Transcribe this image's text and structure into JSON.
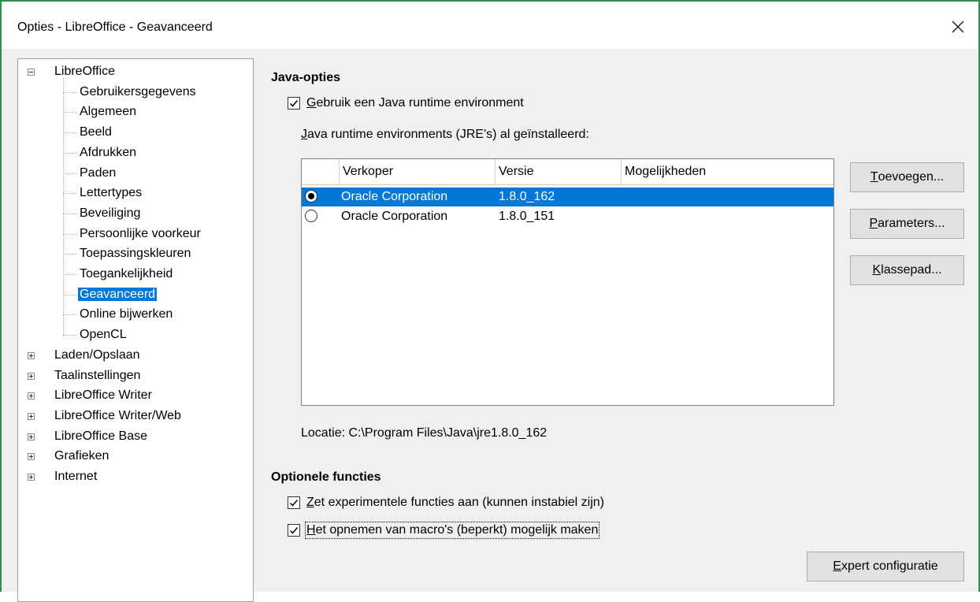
{
  "window": {
    "title": "Opties - LibreOffice - Geavanceerd"
  },
  "tree": {
    "root": "LibreOffice",
    "children": [
      "Gebruikersgegevens",
      "Algemeen",
      "Beeld",
      "Afdrukken",
      "Paden",
      "Lettertypes",
      "Beveiliging",
      "Persoonlijke voorkeur",
      "Toepassingskleuren",
      "Toegankelijkheid",
      "Geavanceerd",
      "Online bijwerken",
      "OpenCL"
    ],
    "selected": "Geavanceerd",
    "collapsed": [
      "Laden/Opslaan",
      "Taalinstellingen",
      "LibreOffice Writer",
      "LibreOffice Writer/Web",
      "LibreOffice Base",
      "Grafieken",
      "Internet"
    ]
  },
  "java": {
    "section_title": "Java-opties",
    "use_jre": {
      "accel": "G",
      "label": "ebruik een Java runtime environment",
      "checked": true
    },
    "installed": {
      "accel": "J",
      "label": "ava runtime environments (JRE's) al geïnstalleerd:"
    },
    "table": {
      "columns": [
        "Verkoper",
        "Versie",
        "Mogelijkheden"
      ],
      "rows": [
        {
          "vendor": "Oracle Corporation",
          "version": "1.8.0_162",
          "selected": true
        },
        {
          "vendor": "Oracle Corporation",
          "version": "1.8.0_151",
          "selected": false
        }
      ]
    },
    "buttons": {
      "add": {
        "accel": "T",
        "rest": "oevoegen..."
      },
      "params": {
        "accel": "P",
        "rest": "arameters..."
      },
      "classpath": {
        "accel": "K",
        "rest": "lassepad..."
      }
    },
    "location": "Locatie: C:\\Program Files\\Java\\jre1.8.0_162"
  },
  "optional": {
    "section_title": "Optionele functies",
    "experimental": {
      "accel": "Z",
      "label": "et experimentele functies aan (kunnen instabiel zijn)",
      "checked": true
    },
    "macros": {
      "accel": "H",
      "label": "et opnemen van macro's (beperkt) mogelijk maken",
      "checked": true
    }
  },
  "expert_button": {
    "accel": "E",
    "rest": "xpert configuratie"
  }
}
